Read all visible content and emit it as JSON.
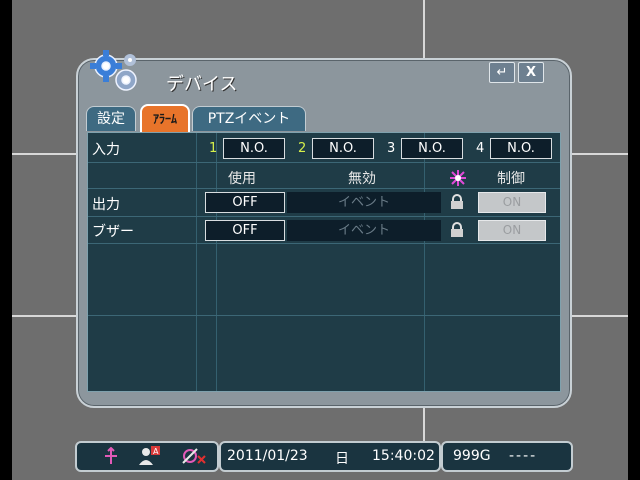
{
  "dialog": {
    "title": "デバイス",
    "enter_icon": "↵",
    "close_label": "X"
  },
  "tabs": [
    {
      "label": "設定",
      "active": false
    },
    {
      "label": "ｱﾗｰﾑ",
      "active": true
    },
    {
      "label": "PTZイベント",
      "active": false
    }
  ],
  "alarm": {
    "input_label": "入力",
    "inputs": [
      {
        "num": "1",
        "value": "N.O.",
        "num_color": "#d6f04a"
      },
      {
        "num": "2",
        "value": "N.O.",
        "num_color": "#d6f04a"
      },
      {
        "num": "3",
        "value": "N.O.",
        "num_color": "#ffffff"
      },
      {
        "num": "4",
        "value": "N.O.",
        "num_color": "#ffffff"
      }
    ],
    "columns": {
      "use": "使用",
      "disable": "無効",
      "control": "制御"
    },
    "rows": [
      {
        "label": "出力",
        "use": "OFF",
        "event": "イベント",
        "control": "ON"
      },
      {
        "label": "ブザー",
        "use": "OFF",
        "event": "イベント",
        "control": "ON"
      }
    ]
  },
  "statusbar": {
    "date": "2011/01/23",
    "weekday": "日",
    "time": "15:40:02",
    "disk": "999G",
    "disk_status": "----"
  },
  "colors": {
    "accent_tab": "#e8742a",
    "panel_bg": "#1f3c47",
    "dialog_bg": "#8c969d"
  }
}
